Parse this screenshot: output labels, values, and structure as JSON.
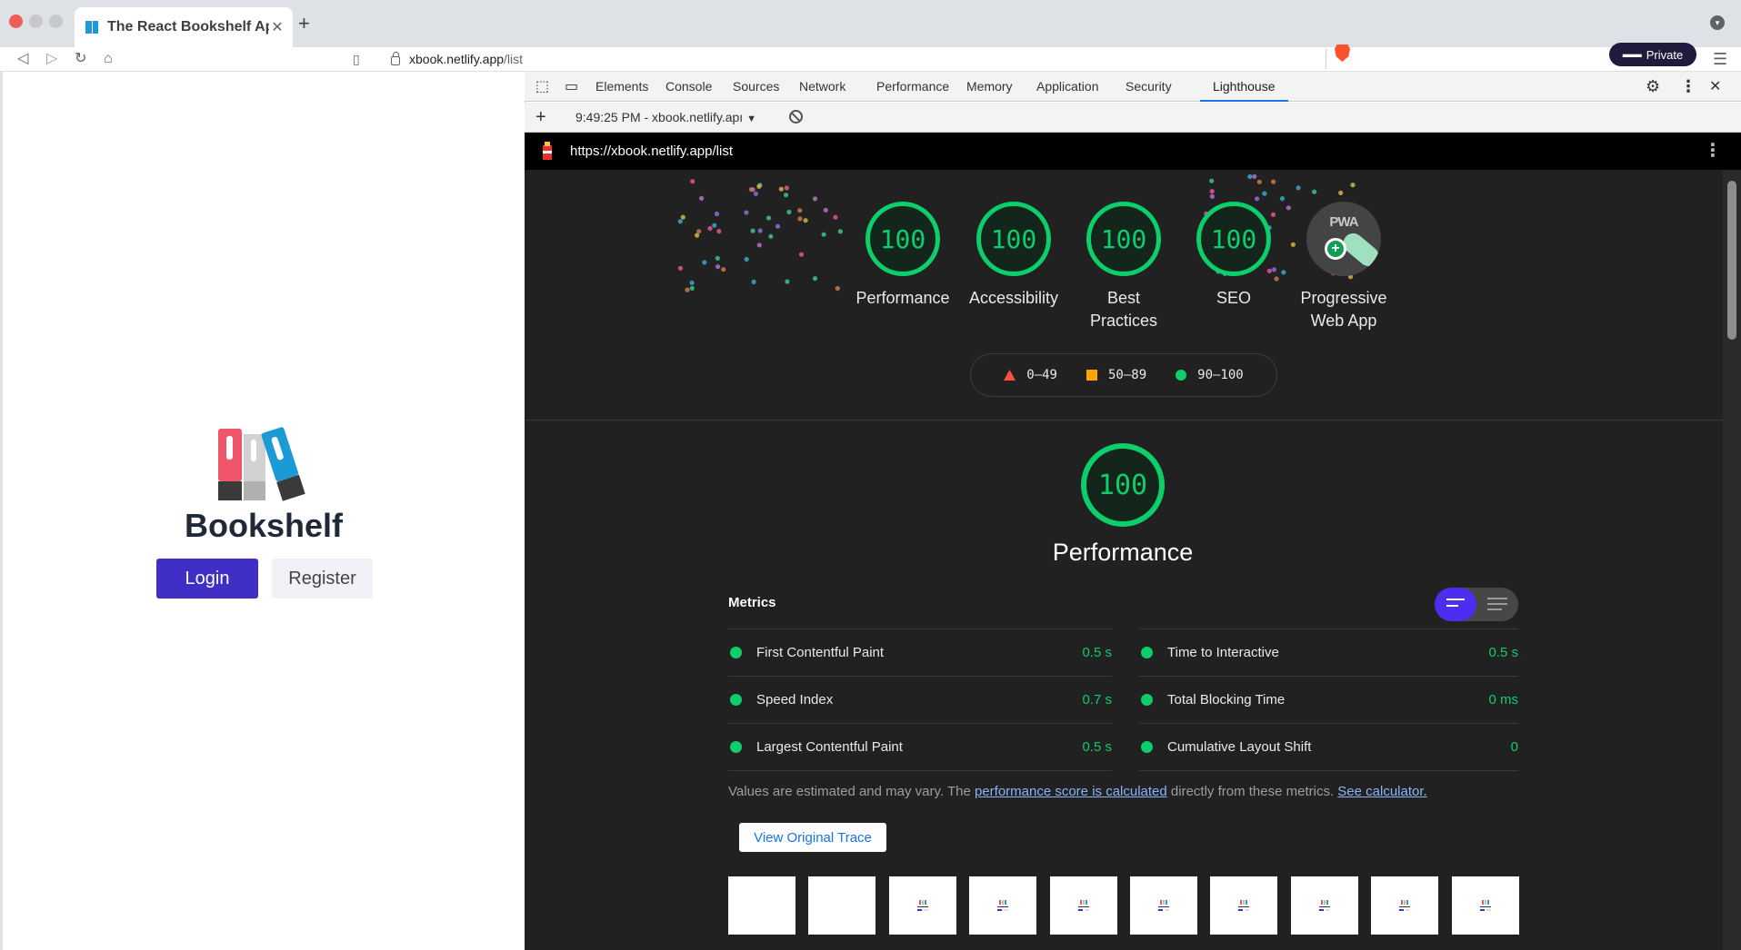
{
  "browser": {
    "tab_title": "The React Bookshelf App",
    "tab_close": "✕",
    "new_tab": "+",
    "url_host": "xbook.netlify.app",
    "url_path": "/list",
    "private_label": "Private"
  },
  "page": {
    "app_name": "Bookshelf",
    "login_label": "Login",
    "register_label": "Register"
  },
  "devtools": {
    "tabs": [
      "Elements",
      "Console",
      "Sources",
      "Network",
      "Performance",
      "Memory",
      "Application",
      "Security",
      "Lighthouse"
    ],
    "active_tab": "Lighthouse",
    "report_label": "9:49:25 PM - xbook.netlify.apı"
  },
  "lighthouse": {
    "url": "https://xbook.netlify.app/list",
    "gauges": [
      {
        "score": "100",
        "label": "Performance"
      },
      {
        "score": "100",
        "label": "Accessibility"
      },
      {
        "score": "100",
        "label_line1": "Best",
        "label_line2": "Practices"
      },
      {
        "score": "100",
        "label": "SEO"
      }
    ],
    "pwa": {
      "badge": "PWA",
      "label_line1": "Progressive",
      "label_line2": "Web App"
    },
    "legend": {
      "fail": "0–49",
      "average": "50–89",
      "pass": "90–100"
    },
    "performance": {
      "score": "100",
      "title": "Performance",
      "metrics_header": "Metrics",
      "metrics_left": [
        {
          "name": "First Contentful Paint",
          "value": "0.5 s"
        },
        {
          "name": "Speed Index",
          "value": "0.7 s"
        },
        {
          "name": "Largest Contentful Paint",
          "value": "0.5 s"
        }
      ],
      "metrics_right": [
        {
          "name": "Time to Interactive",
          "value": "0.5 s"
        },
        {
          "name": "Total Blocking Time",
          "value": "0 ms"
        },
        {
          "name": "Cumulative Layout Shift",
          "value": "0"
        }
      ],
      "note_prefix": "Values are estimated and may vary. The ",
      "note_link1": "performance score is calculated",
      "note_middle": " directly from these metrics. ",
      "note_link2": "See calculator.",
      "view_trace": "View Original Trace"
    },
    "colors": {
      "pass": "#0cce6b",
      "average": "#ffa400",
      "fail": "#ff4e42",
      "background": "#212121"
    }
  }
}
